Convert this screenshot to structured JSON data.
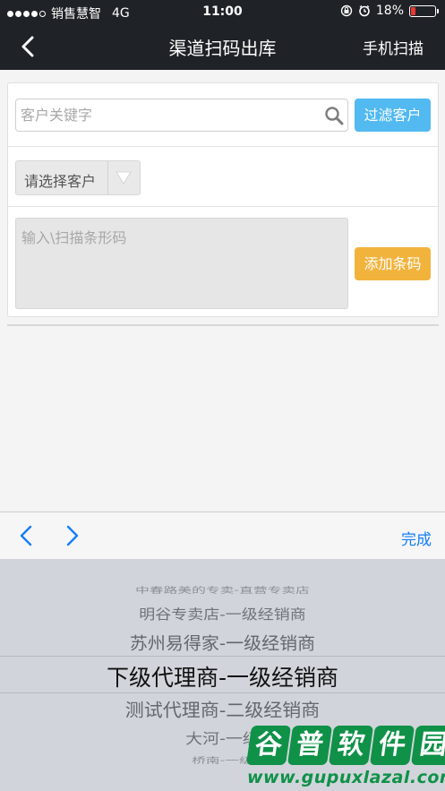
{
  "status_bar": {
    "carrier": "销售慧智",
    "network": "4G",
    "time": "11:00",
    "battery_percent": "18%",
    "battery_level": 0.18,
    "signal_bars_filled": 4,
    "signal_bars_total": 5
  },
  "nav": {
    "back_icon": "chevron-left-icon",
    "title": "渠道扫码出库",
    "action_label": "手机扫描"
  },
  "form": {
    "customer_keyword_placeholder": "客户关键字",
    "search_icon": "search-icon",
    "filter_button_label": "过滤客户",
    "customer_select_label": "请选择客户",
    "select_arrow_icon": "triangle-down-icon",
    "barcode_placeholder": "输入\\扫描条形码",
    "add_barcode_button_label": "添加条码"
  },
  "picker_toolbar": {
    "prev_icon": "chevron-left-icon",
    "next_icon": "chevron-right-icon",
    "done_label": "完成"
  },
  "picker": {
    "options": [
      "中春路美的专卖-直营专卖店",
      "明谷专卖店-一级经销商",
      "苏州易得家-一级经销商",
      "下级代理商-一级经销商",
      "测试代理商-二级经销商",
      "大河-一级",
      "桥南-一级"
    ],
    "selected_index": 3,
    "selected_value": "下级代理商-一级经销商"
  },
  "watermark": {
    "chars": [
      "谷",
      "普",
      "软",
      "件",
      "园"
    ],
    "url": "www.gupuxlazal.com"
  },
  "colors": {
    "nav_background": "#1f2226",
    "filter_button": "#52b9f1",
    "add_button": "#f2b33d",
    "done_text": "#147efb",
    "picker_background": "#d1d5db",
    "watermark_green": "#0f9148"
  }
}
